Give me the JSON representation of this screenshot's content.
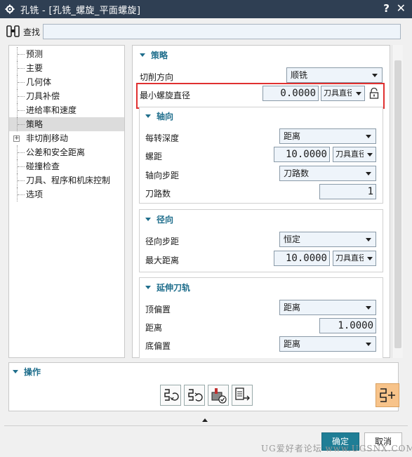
{
  "window": {
    "title": "孔铣 - [孔铣_螺旋_平面螺旋]",
    "help": "?",
    "close": "✕"
  },
  "find": {
    "label": "查找",
    "value": ""
  },
  "tree": {
    "items": [
      {
        "label": "预测"
      },
      {
        "label": "主要"
      },
      {
        "label": "几何体"
      },
      {
        "label": "刀具补偿"
      },
      {
        "label": "进给率和速度"
      },
      {
        "label": "策略"
      },
      {
        "label": "非切削移动"
      },
      {
        "label": "公差和安全距离"
      },
      {
        "label": "碰撞检查"
      },
      {
        "label": "刀具、程序和机床控制"
      },
      {
        "label": "选项"
      }
    ]
  },
  "strategy": {
    "title": "策略",
    "cut_direction": {
      "label": "切削方向",
      "value": "顺铣"
    },
    "min_helix_diameter": {
      "label": "最小螺旋直径",
      "value": "0.0000",
      "unit": "刀具直径"
    }
  },
  "axial": {
    "title": "轴向",
    "depth_per_rev": {
      "label": "每转深度",
      "value": "距离"
    },
    "pitch": {
      "label": "螺距",
      "value": "10.0000",
      "unit": "刀具直径"
    },
    "axial_stepover": {
      "label": "轴向步距",
      "value": "刀路数"
    },
    "num_passes": {
      "label": "刀路数",
      "value": "1"
    }
  },
  "radial": {
    "title": "径向",
    "radial_stepover": {
      "label": "径向步距",
      "value": "恒定"
    },
    "max_distance": {
      "label": "最大距离",
      "value": "10.0000",
      "unit": "刀具直径"
    }
  },
  "extend": {
    "title": "延伸刀轨",
    "top_offset": {
      "label": "顶偏置",
      "value": "距离"
    },
    "distance": {
      "label": "距离",
      "value": "1.0000"
    },
    "bottom_offset": {
      "label": "底偏置",
      "value": "距离"
    }
  },
  "operations": {
    "title": "操作"
  },
  "buttons": {
    "ok": "确定",
    "cancel": "取消"
  },
  "watermark": "UG爱好者论坛 www.UGSNX.COM",
  "colors": {
    "titlebar": "#2f3f53",
    "section": "#1f6e8c",
    "ok": "#1f7e96",
    "highlight": "#e03030"
  }
}
